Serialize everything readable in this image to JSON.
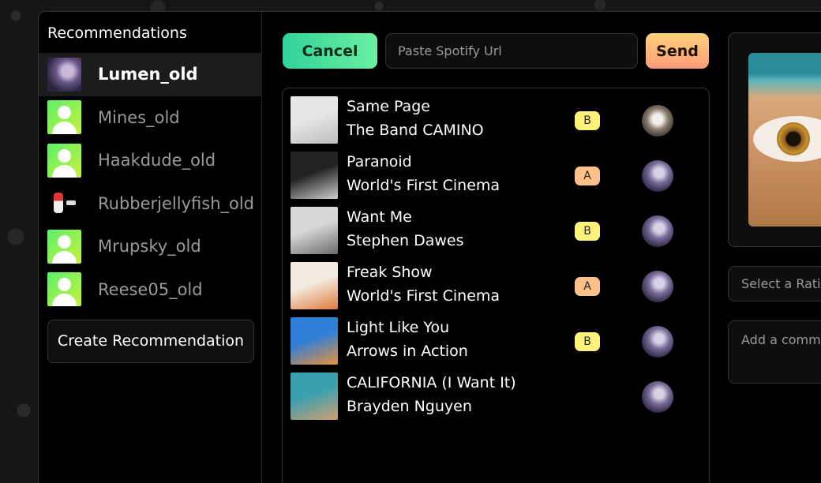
{
  "sidebar": {
    "title": "Recommendations",
    "users": [
      {
        "name": "Lumen_old",
        "active": true,
        "avatar": "photo"
      },
      {
        "name": "Mines_old",
        "active": false,
        "avatar": "default"
      },
      {
        "name": "Haakdude_old",
        "active": false,
        "avatar": "default"
      },
      {
        "name": "Rubberjellyfish_old",
        "active": false,
        "avatar": "figure"
      },
      {
        "name": "Mrupsky_old",
        "active": false,
        "avatar": "default"
      },
      {
        "name": "Reese05_old",
        "active": false,
        "avatar": "default"
      }
    ],
    "create_label": "Create Recommendation"
  },
  "toolbar": {
    "cancel_label": "Cancel",
    "url_placeholder": "Paste Spotify Url",
    "send_label": "Send"
  },
  "tracks": [
    {
      "title": "Same Page",
      "artist": "The Band CAMINO",
      "grade": "B",
      "cover_colors": [
        "#e6e6e6",
        "#bdbdbd"
      ],
      "avatar": "dog"
    },
    {
      "title": "Paranoid",
      "artist": "World's First Cinema",
      "grade": "A",
      "cover_colors": [
        "#222222",
        "#cfcfcf"
      ],
      "avatar": "photo"
    },
    {
      "title": "Want Me",
      "artist": "Stephen Dawes",
      "grade": "B",
      "cover_colors": [
        "#d8d8d8",
        "#6b6b6b"
      ],
      "avatar": "photo"
    },
    {
      "title": "Freak Show",
      "artist": "World's First Cinema",
      "grade": "A",
      "cover_colors": [
        "#f2ece0",
        "#e07a3a"
      ],
      "avatar": "photo"
    },
    {
      "title": "Light Like You",
      "artist": "Arrows in Action",
      "grade": "B",
      "cover_colors": [
        "#2f7fd8",
        "#e8923a"
      ],
      "avatar": "photo"
    },
    {
      "title": "CALIFORNIA (I Want It)",
      "artist": "Brayden Nguyen",
      "grade": "",
      "cover_colors": [
        "#3aa0b0",
        "#d0a070"
      ],
      "avatar": "photo"
    }
  ],
  "right_panel": {
    "rating_placeholder": "Select a Rating",
    "comment_placeholder": "Add a comment"
  },
  "colors": {
    "accent_green": "#2fd39a",
    "accent_orange": "#ff9a7a",
    "grade_b": "#fff27a",
    "grade_a": "#ffc08a"
  }
}
